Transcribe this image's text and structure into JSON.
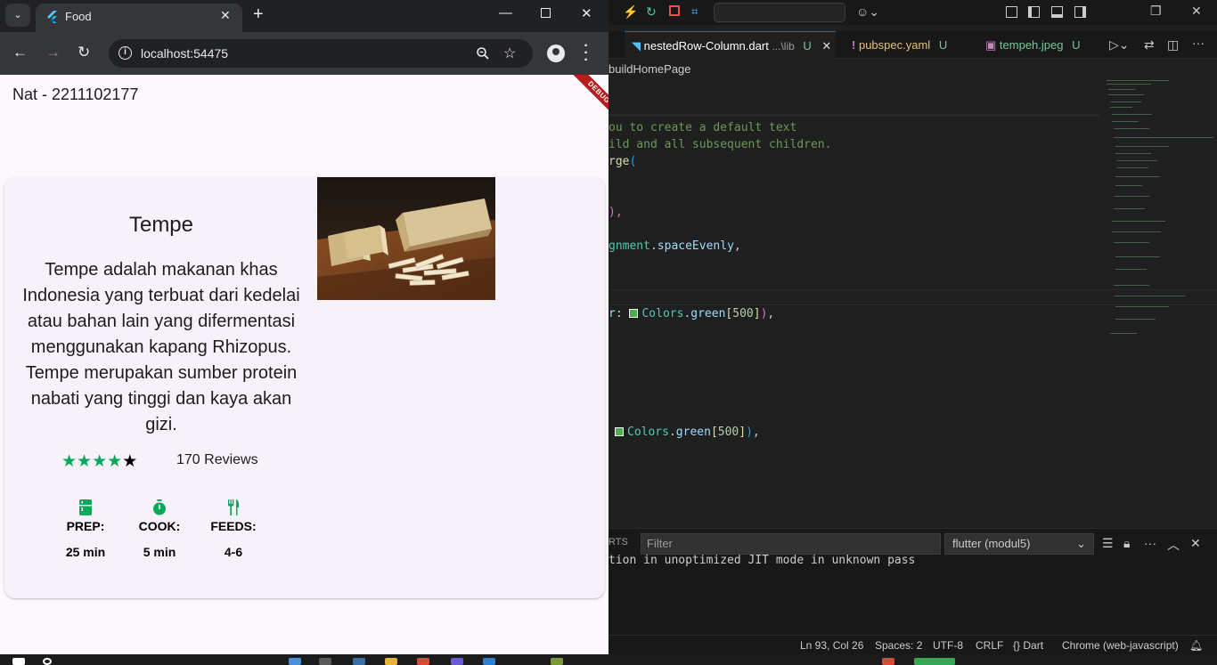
{
  "chrome": {
    "tab_title": "Food",
    "url": "localhost:54475"
  },
  "app": {
    "title": "Nat - 2211102177",
    "debug_banner": "DEBUG",
    "card": {
      "name": "Tempe",
      "description": "Tempe adalah makanan khas Indonesia yang terbuat dari kedelai atau bahan lain yang difermentasi menggunakan kapang Rhizopus. Tempe merupakan sumber protein nabati yang tinggi dan kaya akan gizi.",
      "rating": {
        "value": 4,
        "max": 5,
        "star_color": "#09a85a"
      },
      "reviews": "170 Reviews",
      "stats": [
        {
          "icon": "kitchen-icon",
          "label": "PREP:",
          "value": "25 min"
        },
        {
          "icon": "timer-icon",
          "label": "COOK:",
          "value": "5 min"
        },
        {
          "icon": "restaurant-icon",
          "label": "FEEDS:",
          "value": "4-6"
        }
      ],
      "accent_color": "#09a85a"
    }
  },
  "vscode": {
    "tabs": [
      {
        "name": "nestedRow-Column.dart",
        "path": "...\\lib",
        "status": "U"
      },
      {
        "name": "pubspec.yaml",
        "status": "U"
      },
      {
        "name": "tempeh.jpeg",
        "status": "U"
      }
    ],
    "breadcrumb": "buildHomePage",
    "code": {
      "line1": "ou to create a default text",
      "line2": "ild and all subsequent children.",
      "line3_fn": "rge",
      "line4": "),",
      "line5_a": "gnment",
      "line5_b": "spaceEvenly",
      "line6_prop": "r:",
      "colors": "Colors",
      "green": "green",
      "num": "500"
    },
    "panel": {
      "tab": "RTS",
      "filter_placeholder": "Filter",
      "channel": "flutter (modul5)",
      "output": "tion in unoptimized JIT mode in unknown pass"
    },
    "status": {
      "position": "Ln 93, Col 26",
      "spaces": "Spaces: 2",
      "encoding": "UTF-8",
      "eol": "CRLF",
      "language": "Dart",
      "device": "Chrome (web-javascript)"
    }
  }
}
